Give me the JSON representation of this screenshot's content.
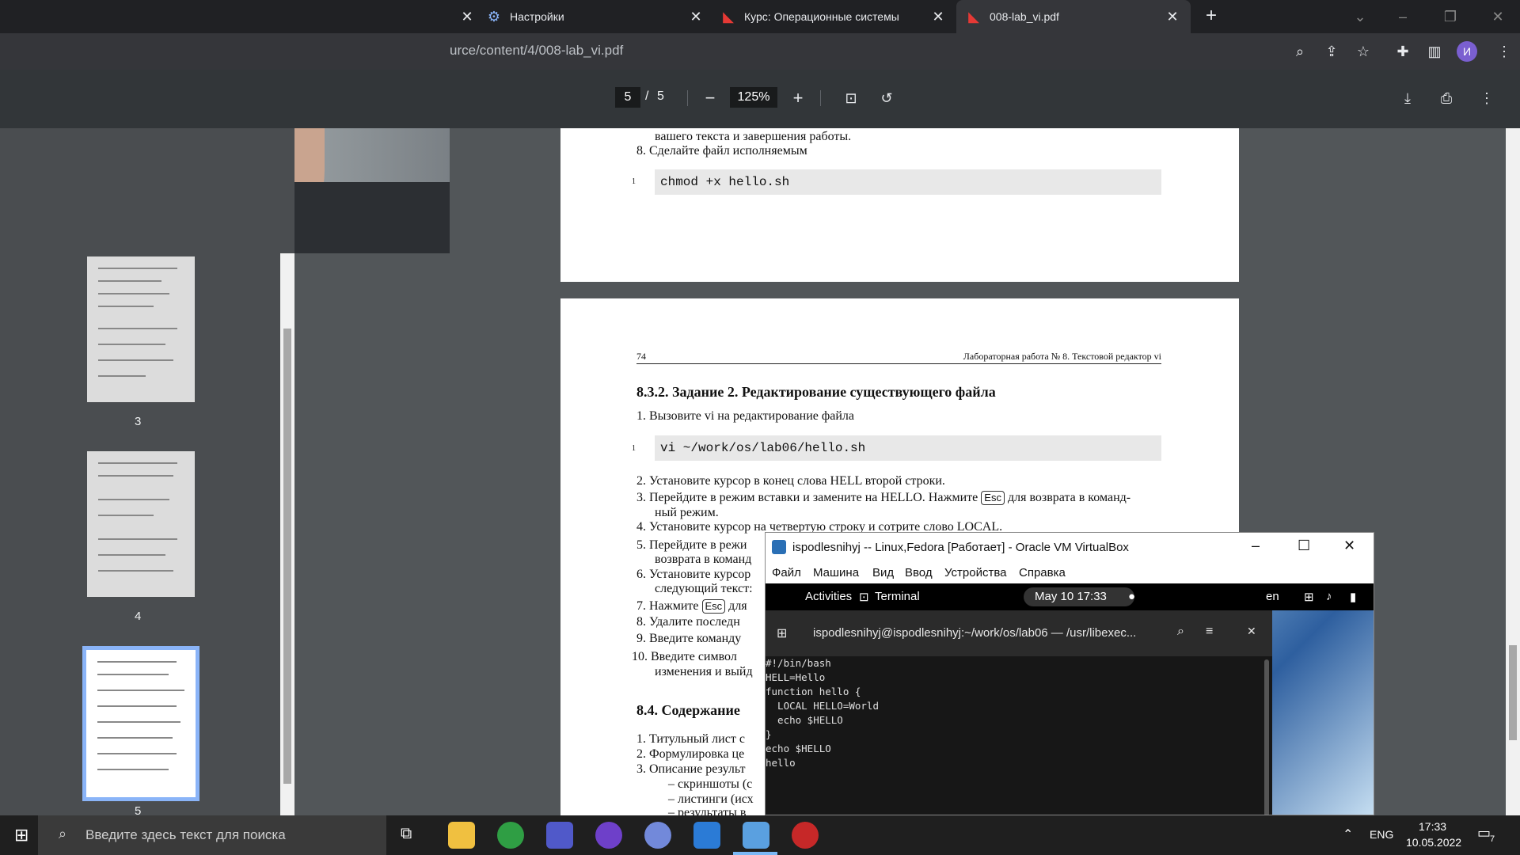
{
  "tabs": [
    {
      "title": "Настройки",
      "active": false
    },
    {
      "title": "Курс: Операционные системы",
      "active": false
    },
    {
      "title": "008-lab_vi.pdf",
      "active": true
    }
  ],
  "address": {
    "url": "urce/content/4/008-lab_vi.pdf"
  },
  "profile": {
    "initial": "И"
  },
  "pdf_toolbar": {
    "current_page": "5",
    "separator": "/",
    "total_pages": "5",
    "zoom": "125%"
  },
  "thumbnails": [
    {
      "label": "3"
    },
    {
      "label": "4"
    },
    {
      "label": "5"
    }
  ],
  "page_top": {
    "cont_text": "вашего текста и завершения работы.",
    "item8": "8.  Сделайте файл исполняемым",
    "code_num": "1",
    "code": "chmod +x hello.sh"
  },
  "page_main": {
    "page_number": "74",
    "running_header": "Лабораторная работа № 8. Текстовой редактор vi",
    "section": "8.3.2.    Задание 2. Редактирование существующего файла",
    "item1": "1.  Вызовите vi на редактирование файла",
    "code_num": "1",
    "code": "vi ~/work/os/lab06/hello.sh",
    "item2": "2.  Установите курсор в конец слова HELL второй строки.",
    "item3a": "3.  Перейдите в режим вставки и замените на HELLO. Нажмите",
    "item3_key": "Esc",
    "item3b": "для возврата в команд-",
    "item3c": "ный режим.",
    "item4": "4.  Установите курсор на четвертую строку и сотрите слово LOCAL.",
    "item5a": "5.  Перейдите в режи",
    "item5b": "возврата в команд",
    "item6a": "6.  Установите курсор",
    "item6b": "следующий текст:",
    "item7a": "7.  Нажмите",
    "item7_key": "Esc",
    "item7b": "для",
    "item8": "8.  Удалите последн",
    "item9": "9.  Введите команду",
    "item10a": "10.  Введите символ",
    "item10b": "изменения и выйд",
    "section2": "8.4.    Содержание",
    "r1": "1.  Титульный лист с",
    "r2": "2.  Формулировка це",
    "r3": "3.  Описание результ",
    "r3a": "–  скриншоты (с",
    "r3b": "–  листинги (исх",
    "r3c": "–  результаты в"
  },
  "vbox": {
    "title": "ispodlesnihyj -- Linux,Fedora [Работает] - Oracle VM VirtualBox",
    "menu": [
      "Файл",
      "Машина",
      "Вид",
      "Ввод",
      "Устройства",
      "Справка"
    ],
    "gnome": {
      "activities": "Activities",
      "app": "Terminal",
      "clock": "May 10  17:33",
      "lang": "en"
    },
    "terminal_title": "ispodlesnihyj@ispodlesnihyj:~/work/os/lab06 — /usr/libexec...",
    "terminal_lines": "#!/bin/bash\nHELL=Hello\nfunction hello {\n  LOCAL HELLO=World\n  echo $HELLO\n}\necho $HELLO\nhello"
  },
  "taskbar": {
    "search_placeholder": "Введите здесь текст для поиска",
    "lang": "ENG",
    "time": "17:33",
    "date": "10.05.2022",
    "notifications": "7"
  }
}
